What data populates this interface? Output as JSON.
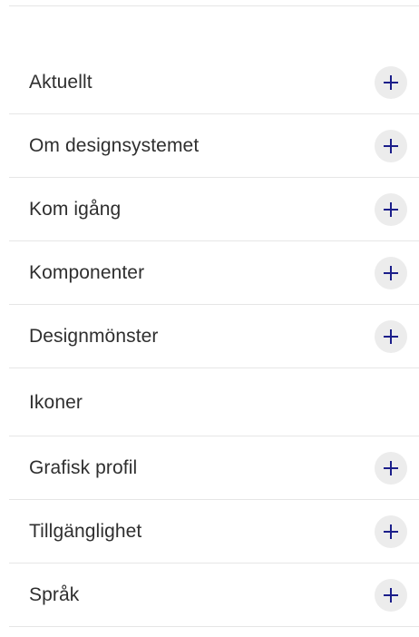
{
  "nav": {
    "items": [
      {
        "label": "Aktuellt",
        "expandable": true
      },
      {
        "label": "Om designsystemet",
        "expandable": true
      },
      {
        "label": "Kom igång",
        "expandable": true
      },
      {
        "label": "Komponenter",
        "expandable": true
      },
      {
        "label": "Designmönster",
        "expandable": true
      },
      {
        "label": "Ikoner",
        "expandable": false
      },
      {
        "label": "Grafisk profil",
        "expandable": true
      },
      {
        "label": "Tillgänglighet",
        "expandable": true
      },
      {
        "label": "Språk",
        "expandable": true
      }
    ]
  },
  "colors": {
    "icon": "#1b1e8a",
    "button_bg": "#ececec",
    "divider": "#e6e6e6",
    "text": "#2f2f2f"
  },
  "icons": {
    "expand": "plus-icon"
  }
}
